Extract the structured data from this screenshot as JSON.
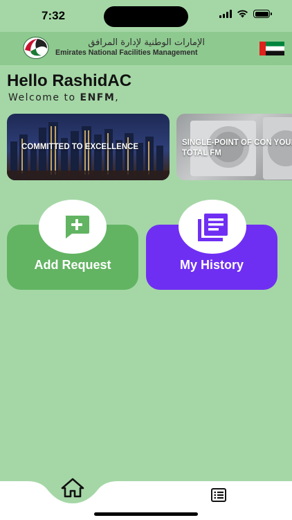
{
  "status_bar": {
    "time": "7:32"
  },
  "header": {
    "org_name_ar": "الإمارات الوطنية لإدارة المرافق",
    "org_name_en": "Emirates National Facilities Management",
    "logo_icon": "enfm-logo-icon",
    "flag_icon": "uae-flag-icon"
  },
  "greeting": {
    "title": "Hello RashidAC",
    "welcome_prefix": "Welcome to ",
    "welcome_brand": "ENFM",
    "welcome_suffix": ","
  },
  "banners": [
    {
      "text": "COMMITTED TO EXCELLENCE",
      "image": "dubai-skyline-night"
    },
    {
      "text": "SINGLE-POINT OF CON YOUR TOTAL FM",
      "image": "air-conditioner-units"
    }
  ],
  "actions": {
    "add_request": {
      "label": "Add Request",
      "icon": "add-comment-icon",
      "color": "#62b462"
    },
    "my_history": {
      "label": "My History",
      "icon": "library-books-icon",
      "color": "#6f2ff3"
    }
  },
  "tabbar": {
    "items": [
      {
        "icon": "home-icon",
        "active": true
      },
      {
        "icon": "list-icon",
        "active": false
      }
    ]
  },
  "colors": {
    "background": "#a5d7a6",
    "header": "#8ec98f",
    "accent_green": "#62b462",
    "accent_purple": "#6f2ff3"
  }
}
